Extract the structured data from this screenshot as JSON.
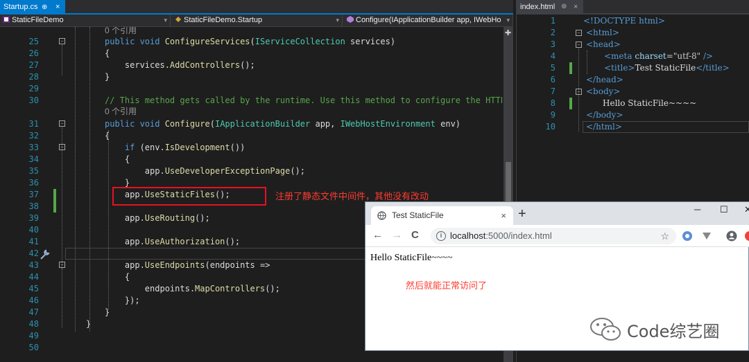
{
  "left_editor": {
    "tab": {
      "label": "Startup.cs",
      "pin": "⊕",
      "close": "×"
    },
    "nav": {
      "project": "StaticFileDemo",
      "class": "StaticFileDemo.Startup",
      "member": "Configure(IApplicationBuilder app, IWebHo"
    },
    "line_numbers": [
      "25",
      "26",
      "27",
      "28",
      "29",
      "30",
      "31",
      "32",
      "33",
      "34",
      "35",
      "36",
      "37",
      "38",
      "39",
      "40",
      "41",
      "42",
      "43",
      "44",
      "45",
      "46",
      "47",
      "48",
      "49",
      "50"
    ],
    "ref_label_1": "0 个引用",
    "ref_label_2": "0 个引用",
    "lines": {
      "l25_kw": "public void ",
      "l25_fn": "ConfigureServices",
      "l25_a": "(",
      "l25_ty": "IServiceCollection",
      "l25_b": " services)",
      "l26": "{",
      "l27_a": "    services.",
      "l27_fn": "AddControllers",
      "l27_b": "();",
      "l28": "}",
      "l30": "// This method gets called by the runtime. Use this method to configure the HTTP r",
      "l31_kw": "public void ",
      "l31_fn": "Configure",
      "l31_a": "(",
      "l31_ty1": "IApplicationBuilder",
      "l31_b": " app, ",
      "l31_ty2": "IWebHostEnvironment",
      "l31_c": " env)",
      "l32": "{",
      "l33_kw": "    if ",
      "l33_a": "(env.",
      "l33_fn": "IsDevelopment",
      "l33_b": "())",
      "l34": "    {",
      "l35_a": "        app.",
      "l35_fn": "UseDeveloperExceptionPage",
      "l35_b": "();",
      "l36": "    }",
      "l37_a": "    app.",
      "l37_fn": "UseStaticFiles",
      "l37_b": "();",
      "l39_a": "    app.",
      "l39_fn": "UseRouting",
      "l39_b": "();",
      "l41_a": "    app.",
      "l41_fn": "UseAuthorization",
      "l41_b": "();",
      "l43_a": "    app.",
      "l43_fn": "UseEndpoints",
      "l43_b": "(endpoints =>",
      "l44": "    {",
      "l45_a": "        endpoints.",
      "l45_fn": "MapControllers",
      "l45_b": "();",
      "l46": "    });",
      "l47": "}",
      "l48": "}",
      "l49": "}"
    },
    "annotation": "注册了静态文件中间件，其他没有改动"
  },
  "right_editor": {
    "tab": {
      "label": "index.html",
      "pin": "⊕",
      "close": "×"
    },
    "line_numbers": [
      "1",
      "2",
      "3",
      "4",
      "5",
      "6",
      "7",
      "8",
      "9",
      "10"
    ],
    "doctype": "<!DOCTYPE html>",
    "html_open": "<html>",
    "head_open": "<head>",
    "meta_tag": "<meta",
    "meta_attr": " charset",
    "meta_eq": "=",
    "meta_val": "\"utf-8\"",
    "meta_close": " />",
    "title_open": "<title>",
    "title_text": "Test StaticFile",
    "title_close": "</title>",
    "head_close": "</head>",
    "body_open": "<body>",
    "body_text": "Hello StaticFile~~~~",
    "body_close": "</body>",
    "html_close": "</html>"
  },
  "browser": {
    "tab_title": "Test StaticFile",
    "tab_close": "×",
    "new_tab": "+",
    "window_controls": {
      "minimize": "─",
      "maximize": "☐",
      "close": "✕"
    },
    "back": "←",
    "forward": "→",
    "reload": "C",
    "url_host": "localhost",
    "url_path": ":5000/index.html",
    "info_icon": "i",
    "star": "☆",
    "page_text": "Hello StaticFile~~~~",
    "annotation": "然后就能正常访问了"
  },
  "watermark": {
    "text": "Code综艺圈"
  },
  "colors": {
    "accent": "#007acc",
    "annotation_red": "#ff3b30",
    "keyword": "#569cd6",
    "type": "#4ec9b0",
    "comment": "#57a64a",
    "method": "#dcdcaa"
  }
}
